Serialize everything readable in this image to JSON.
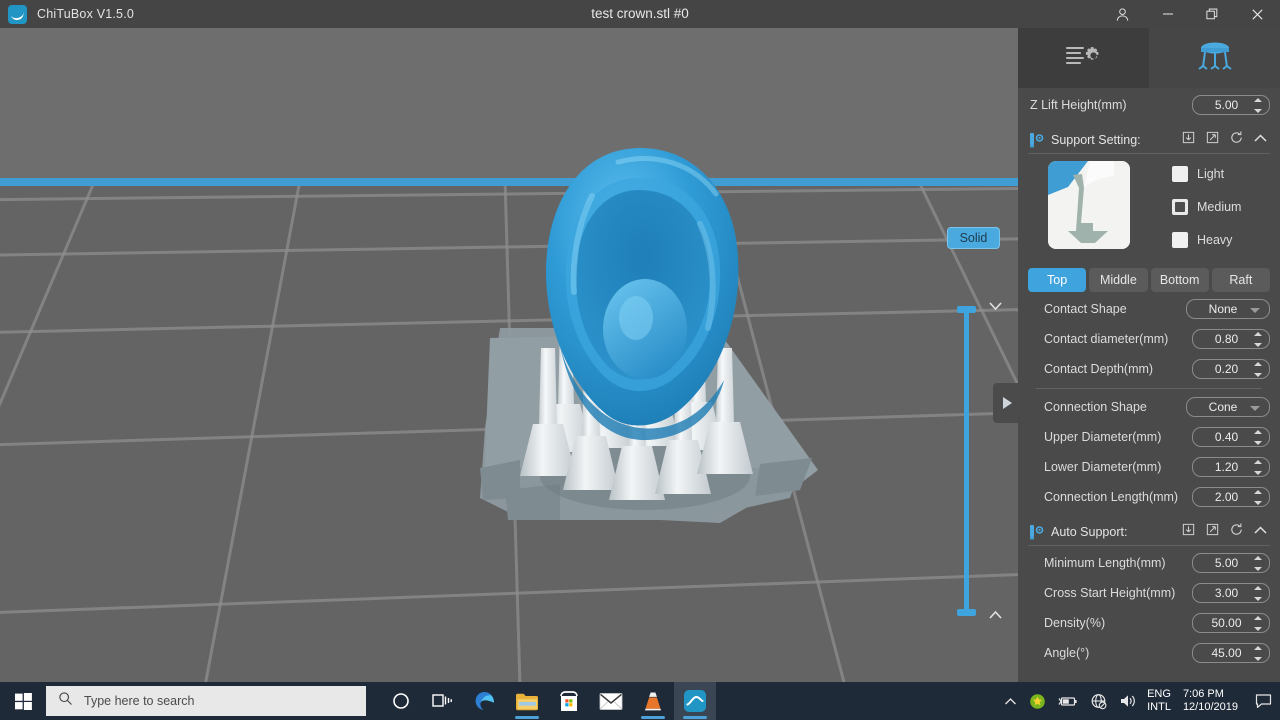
{
  "titlebar": {
    "app_title": "ChiTuBox V1.5.0",
    "document_title": "test crown.stl #0",
    "logo_icon": "chitubox-logo-icon",
    "account_icon": "user-account-icon",
    "minimize_icon": "minimize-icon",
    "restore_icon": "restore-window-icon",
    "close_icon": "close-icon"
  },
  "viewport": {
    "render_mode_label": "Solid",
    "slider_top_icon": "chevron-down-icon",
    "slider_bottom_icon": "chevron-up-icon",
    "expander_icon": "panel-expand-arrow-icon",
    "model_name": "dental-crown-model",
    "grid_color": "#646464",
    "horizon_color": "#3f9dd4",
    "model_color": "#2f9bd6",
    "support_color": "#e8ecef",
    "raft_color": "#8d9aa0"
  },
  "panel": {
    "tabs": [
      {
        "name": "settings-tab",
        "icon": "slice-settings-gear-icon",
        "active": false
      },
      {
        "name": "support-tab",
        "icon": "support-pillars-icon",
        "active": true
      }
    ],
    "z_lift": {
      "label": "Z Lift Height(mm)",
      "value": "5.00"
    },
    "support_setting": {
      "title": "Support Setting:",
      "section_icon": "support-setting-icon",
      "actions": [
        "import-icon",
        "export-icon",
        "reset-icon",
        "collapse-icon"
      ],
      "presets": [
        {
          "label": "Light",
          "selected": false
        },
        {
          "label": "Medium",
          "selected": true
        },
        {
          "label": "Heavy",
          "selected": false
        }
      ],
      "segments": [
        {
          "label": "Top",
          "active": true
        },
        {
          "label": "Middle",
          "active": false
        },
        {
          "label": "Bottom",
          "active": false
        },
        {
          "label": "Raft",
          "active": false
        }
      ],
      "fields": [
        {
          "label": "Contact Shape",
          "value": "None",
          "type": "select"
        },
        {
          "label": "Contact diameter(mm)",
          "value": "0.80",
          "type": "spin"
        },
        {
          "label": "Contact Depth(mm)",
          "value": "0.20",
          "type": "spin"
        },
        {
          "label": "Connection Shape",
          "value": "Cone",
          "type": "select"
        },
        {
          "label": "Upper Diameter(mm)",
          "value": "0.40",
          "type": "spin"
        },
        {
          "label": "Lower Diameter(mm)",
          "value": "1.20",
          "type": "spin"
        },
        {
          "label": "Connection Length(mm)",
          "value": "2.00",
          "type": "spin"
        }
      ]
    },
    "auto_support": {
      "title": "Auto Support:",
      "section_icon": "auto-support-icon",
      "actions": [
        "import-icon",
        "export-icon",
        "reset-icon",
        "collapse-icon"
      ],
      "fields": [
        {
          "label": "Minimum Length(mm)",
          "value": "5.00",
          "type": "spin"
        },
        {
          "label": "Cross Start Height(mm)",
          "value": "3.00",
          "type": "spin"
        },
        {
          "label": "Density(%)",
          "value": "50.00",
          "type": "spin"
        },
        {
          "label": "Angle(°)",
          "value": "45.00",
          "type": "spin"
        }
      ]
    }
  },
  "taskbar": {
    "start_icon": "windows-start-icon",
    "search_placeholder": "Type here to search",
    "search_icon": "search-icon",
    "items": [
      {
        "name": "cortana-icon",
        "running": false,
        "focus": false
      },
      {
        "name": "task-view-icon",
        "running": false,
        "focus": false
      },
      {
        "name": "edge-browser-icon",
        "running": false,
        "focus": false
      },
      {
        "name": "file-explorer-icon",
        "running": true,
        "focus": false
      },
      {
        "name": "microsoft-store-icon",
        "running": false,
        "focus": false
      },
      {
        "name": "mail-icon",
        "running": false,
        "focus": false
      },
      {
        "name": "vlc-player-icon",
        "running": true,
        "focus": false
      },
      {
        "name": "chitubox-taskbar-icon",
        "running": true,
        "focus": true
      }
    ],
    "tray": {
      "overflow_icon": "show-hidden-icons-chevron",
      "shield_icon": "security-shield-icon",
      "battery_icon": "battery-icon",
      "network_icon": "network-no-internet-icon",
      "volume_icon": "volume-icon",
      "language_line1": "ENG",
      "language_line2": "INTL",
      "time": "7:06 PM",
      "date": "12/10/2019",
      "action_center_icon": "action-center-icon"
    }
  }
}
